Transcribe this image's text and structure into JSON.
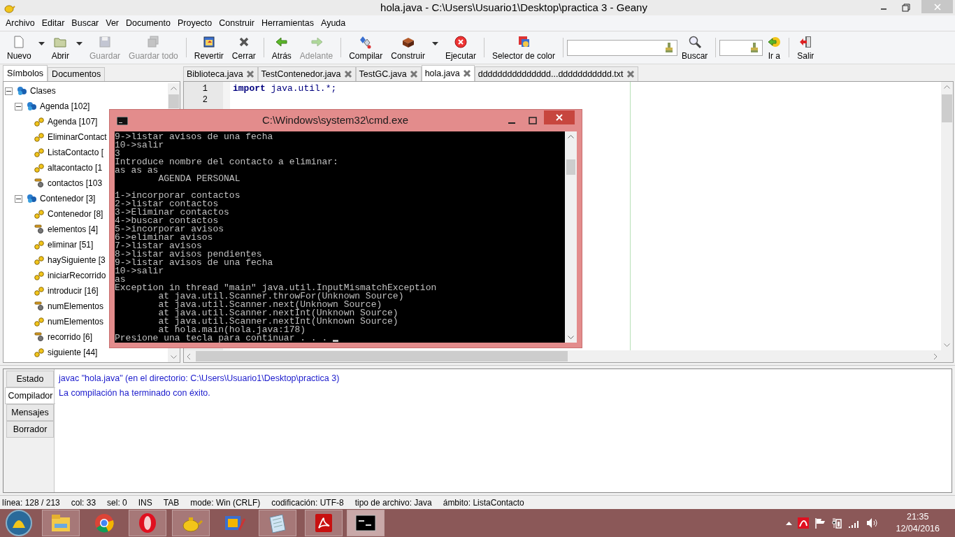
{
  "window": {
    "title": "hola.java - C:\\Users\\Usuario1\\Desktop\\practica 3 - Geany"
  },
  "menu": [
    "Archivo",
    "Editar",
    "Buscar",
    "Ver",
    "Documento",
    "Proyecto",
    "Construir",
    "Herramientas",
    "Ayuda"
  ],
  "toolbar": [
    {
      "kind": "button",
      "label": "Nuevo",
      "disabled": false,
      "dropdown": true
    },
    {
      "kind": "button",
      "label": "Abrir",
      "disabled": false,
      "dropdown": true
    },
    {
      "kind": "button",
      "label": "Guardar",
      "disabled": true,
      "dropdown": false
    },
    {
      "kind": "button",
      "label": "Guardar todo",
      "disabled": true,
      "dropdown": false
    },
    {
      "kind": "separator"
    },
    {
      "kind": "button",
      "label": "Revertir",
      "disabled": false,
      "dropdown": false
    },
    {
      "kind": "button",
      "label": "Cerrar",
      "disabled": false,
      "dropdown": false
    },
    {
      "kind": "separator"
    },
    {
      "kind": "button",
      "label": "Atrás",
      "disabled": false,
      "dropdown": false
    },
    {
      "kind": "button",
      "label": "Adelante",
      "disabled": true,
      "dropdown": false
    },
    {
      "kind": "separator"
    },
    {
      "kind": "button",
      "label": "Compilar",
      "disabled": false,
      "dropdown": false
    },
    {
      "kind": "button",
      "label": "Construir",
      "disabled": false,
      "dropdown": true
    },
    {
      "kind": "button",
      "label": "Ejecutar",
      "disabled": false,
      "dropdown": false
    },
    {
      "kind": "separator"
    },
    {
      "kind": "button",
      "label": "Selector de color",
      "disabled": false,
      "dropdown": false
    },
    {
      "kind": "separator"
    },
    {
      "kind": "field",
      "wide": true
    },
    {
      "kind": "button",
      "label": "Buscar",
      "disabled": false,
      "dropdown": false
    },
    {
      "kind": "separator"
    },
    {
      "kind": "field",
      "wide": false
    },
    {
      "kind": "button",
      "label": "Ir a",
      "disabled": false,
      "dropdown": false
    },
    {
      "kind": "separator"
    },
    {
      "kind": "button",
      "label": "Salir",
      "disabled": false,
      "dropdown": false
    }
  ],
  "sidebar": {
    "tabs": [
      {
        "label": "Símbolos",
        "selected": true
      },
      {
        "label": "Documentos",
        "selected": false
      }
    ],
    "tree": [
      {
        "label": "Clases",
        "expanded": true,
        "children": [
          {
            "label": "Agenda [102]",
            "expanded": true,
            "children": [
              {
                "kind": "method",
                "label": "Agenda [107]"
              },
              {
                "kind": "method",
                "label": "EliminarContact"
              },
              {
                "kind": "method",
                "label": "ListaContacto ["
              },
              {
                "kind": "method",
                "label": "altacontacto [1"
              },
              {
                "kind": "field",
                "label": "contactos [103"
              }
            ]
          },
          {
            "label": "Contenedor [3]",
            "expanded": true,
            "children": [
              {
                "kind": "method",
                "label": "Contenedor [8]"
              },
              {
                "kind": "field",
                "label": "elementos [4]"
              },
              {
                "kind": "method",
                "label": "eliminar [51]"
              },
              {
                "kind": "method",
                "label": "haySiguiente [3"
              },
              {
                "kind": "method",
                "label": "iniciarRecorrido"
              },
              {
                "kind": "method",
                "label": "introducir [16]"
              },
              {
                "kind": "field",
                "label": "numElementos"
              },
              {
                "kind": "method",
                "label": "numElementos"
              },
              {
                "kind": "field",
                "label": "recorrido [6]"
              },
              {
                "kind": "method",
                "label": "siguiente [44]"
              }
            ]
          }
        ]
      }
    ]
  },
  "editor": {
    "tabs": [
      {
        "label": "Biblioteca.java",
        "selected": false
      },
      {
        "label": "TestContenedor.java",
        "selected": false
      },
      {
        "label": "TestGC.java",
        "selected": false
      },
      {
        "label": "hola.java",
        "selected": true
      },
      {
        "label": "ddddddddddddddd...ddddddddddd.txt",
        "selected": false
      }
    ],
    "lines": [
      {
        "number": "1",
        "code": "**import** java.util.*;"
      },
      {
        "number": "2"
      }
    ]
  },
  "console": {
    "title": "C:\\Windows\\system32\\cmd.exe",
    "text": "9->listar avisos de una fecha\n10->salir\n3\nIntroduce nombre del contacto a eliminar:\nas as as\n        AGENDA PERSONAL\n\n1->incorporar contactos\n2->listar contactos\n3->Eliminar contactos\n4->buscar contactos\n5->incorporar avisos\n6->eliminar avisos\n7->listar avisos\n8->listar avisos pendientes\n9->listar avisos de una fecha\n10->salir\nas\nException in thread \"main\" java.util.InputMismatchException\n        at java.util.Scanner.throwFor(Unknown Source)\n        at java.util.Scanner.next(Unknown Source)\n        at java.util.Scanner.nextInt(Unknown Source)\n        at java.util.Scanner.nextInt(Unknown Source)\n        at hola.main(hola.java:178)\nPresione una tecla para continuar . . ."
  },
  "messages": {
    "tabs": [
      {
        "label": "Estado",
        "selected": false
      },
      {
        "label": "Compilador",
        "selected": true
      },
      {
        "label": "Mensajes",
        "selected": false
      },
      {
        "label": "Borrador",
        "selected": false
      }
    ],
    "lines": [
      "javac \"hola.java\" (en el directorio: C:\\Users\\Usuario1\\Desktop\\practica 3)",
      "La compilación ha terminado con éxito."
    ]
  },
  "status_bar": [
    "línea: 128 / 213",
    "col: 33",
    "sel: 0",
    "INS",
    "TAB",
    "mode: Win (CRLF)",
    "codificación: UTF-8",
    "tipo de archivo: Java",
    "ámbito: ListaContacto"
  ],
  "taskbar": {
    "apps": [
      {
        "running": true,
        "selected": false
      },
      {
        "running": false,
        "selected": false
      },
      {
        "running": true,
        "selected": false
      },
      {
        "running": true,
        "selected": false
      },
      {
        "running": false,
        "selected": false
      },
      {
        "running": true,
        "selected": false
      },
      {
        "running": true,
        "selected": false
      },
      {
        "running": true,
        "selected": true
      }
    ],
    "time": "21:35",
    "date": "12/04/2016"
  }
}
